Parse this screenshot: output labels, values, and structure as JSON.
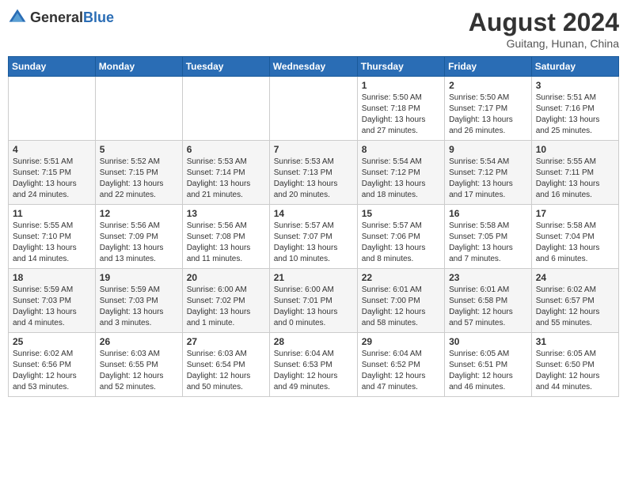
{
  "logo": {
    "general": "General",
    "blue": "Blue"
  },
  "title": {
    "month_year": "August 2024",
    "location": "Guitang, Hunan, China"
  },
  "days_of_week": [
    "Sunday",
    "Monday",
    "Tuesday",
    "Wednesday",
    "Thursday",
    "Friday",
    "Saturday"
  ],
  "weeks": [
    [
      {
        "day": "",
        "info": ""
      },
      {
        "day": "",
        "info": ""
      },
      {
        "day": "",
        "info": ""
      },
      {
        "day": "",
        "info": ""
      },
      {
        "day": "1",
        "info": "Sunrise: 5:50 AM\nSunset: 7:18 PM\nDaylight: 13 hours\nand 27 minutes."
      },
      {
        "day": "2",
        "info": "Sunrise: 5:50 AM\nSunset: 7:17 PM\nDaylight: 13 hours\nand 26 minutes."
      },
      {
        "day": "3",
        "info": "Sunrise: 5:51 AM\nSunset: 7:16 PM\nDaylight: 13 hours\nand 25 minutes."
      }
    ],
    [
      {
        "day": "4",
        "info": "Sunrise: 5:51 AM\nSunset: 7:15 PM\nDaylight: 13 hours\nand 24 minutes."
      },
      {
        "day": "5",
        "info": "Sunrise: 5:52 AM\nSunset: 7:15 PM\nDaylight: 13 hours\nand 22 minutes."
      },
      {
        "day": "6",
        "info": "Sunrise: 5:53 AM\nSunset: 7:14 PM\nDaylight: 13 hours\nand 21 minutes."
      },
      {
        "day": "7",
        "info": "Sunrise: 5:53 AM\nSunset: 7:13 PM\nDaylight: 13 hours\nand 20 minutes."
      },
      {
        "day": "8",
        "info": "Sunrise: 5:54 AM\nSunset: 7:12 PM\nDaylight: 13 hours\nand 18 minutes."
      },
      {
        "day": "9",
        "info": "Sunrise: 5:54 AM\nSunset: 7:12 PM\nDaylight: 13 hours\nand 17 minutes."
      },
      {
        "day": "10",
        "info": "Sunrise: 5:55 AM\nSunset: 7:11 PM\nDaylight: 13 hours\nand 16 minutes."
      }
    ],
    [
      {
        "day": "11",
        "info": "Sunrise: 5:55 AM\nSunset: 7:10 PM\nDaylight: 13 hours\nand 14 minutes."
      },
      {
        "day": "12",
        "info": "Sunrise: 5:56 AM\nSunset: 7:09 PM\nDaylight: 13 hours\nand 13 minutes."
      },
      {
        "day": "13",
        "info": "Sunrise: 5:56 AM\nSunset: 7:08 PM\nDaylight: 13 hours\nand 11 minutes."
      },
      {
        "day": "14",
        "info": "Sunrise: 5:57 AM\nSunset: 7:07 PM\nDaylight: 13 hours\nand 10 minutes."
      },
      {
        "day": "15",
        "info": "Sunrise: 5:57 AM\nSunset: 7:06 PM\nDaylight: 13 hours\nand 8 minutes."
      },
      {
        "day": "16",
        "info": "Sunrise: 5:58 AM\nSunset: 7:05 PM\nDaylight: 13 hours\nand 7 minutes."
      },
      {
        "day": "17",
        "info": "Sunrise: 5:58 AM\nSunset: 7:04 PM\nDaylight: 13 hours\nand 6 minutes."
      }
    ],
    [
      {
        "day": "18",
        "info": "Sunrise: 5:59 AM\nSunset: 7:03 PM\nDaylight: 13 hours\nand 4 minutes."
      },
      {
        "day": "19",
        "info": "Sunrise: 5:59 AM\nSunset: 7:03 PM\nDaylight: 13 hours\nand 3 minutes."
      },
      {
        "day": "20",
        "info": "Sunrise: 6:00 AM\nSunset: 7:02 PM\nDaylight: 13 hours\nand 1 minute."
      },
      {
        "day": "21",
        "info": "Sunrise: 6:00 AM\nSunset: 7:01 PM\nDaylight: 13 hours\nand 0 minutes."
      },
      {
        "day": "22",
        "info": "Sunrise: 6:01 AM\nSunset: 7:00 PM\nDaylight: 12 hours\nand 58 minutes."
      },
      {
        "day": "23",
        "info": "Sunrise: 6:01 AM\nSunset: 6:58 PM\nDaylight: 12 hours\nand 57 minutes."
      },
      {
        "day": "24",
        "info": "Sunrise: 6:02 AM\nSunset: 6:57 PM\nDaylight: 12 hours\nand 55 minutes."
      }
    ],
    [
      {
        "day": "25",
        "info": "Sunrise: 6:02 AM\nSunset: 6:56 PM\nDaylight: 12 hours\nand 53 minutes."
      },
      {
        "day": "26",
        "info": "Sunrise: 6:03 AM\nSunset: 6:55 PM\nDaylight: 12 hours\nand 52 minutes."
      },
      {
        "day": "27",
        "info": "Sunrise: 6:03 AM\nSunset: 6:54 PM\nDaylight: 12 hours\nand 50 minutes."
      },
      {
        "day": "28",
        "info": "Sunrise: 6:04 AM\nSunset: 6:53 PM\nDaylight: 12 hours\nand 49 minutes."
      },
      {
        "day": "29",
        "info": "Sunrise: 6:04 AM\nSunset: 6:52 PM\nDaylight: 12 hours\nand 47 minutes."
      },
      {
        "day": "30",
        "info": "Sunrise: 6:05 AM\nSunset: 6:51 PM\nDaylight: 12 hours\nand 46 minutes."
      },
      {
        "day": "31",
        "info": "Sunrise: 6:05 AM\nSunset: 6:50 PM\nDaylight: 12 hours\nand 44 minutes."
      }
    ]
  ]
}
